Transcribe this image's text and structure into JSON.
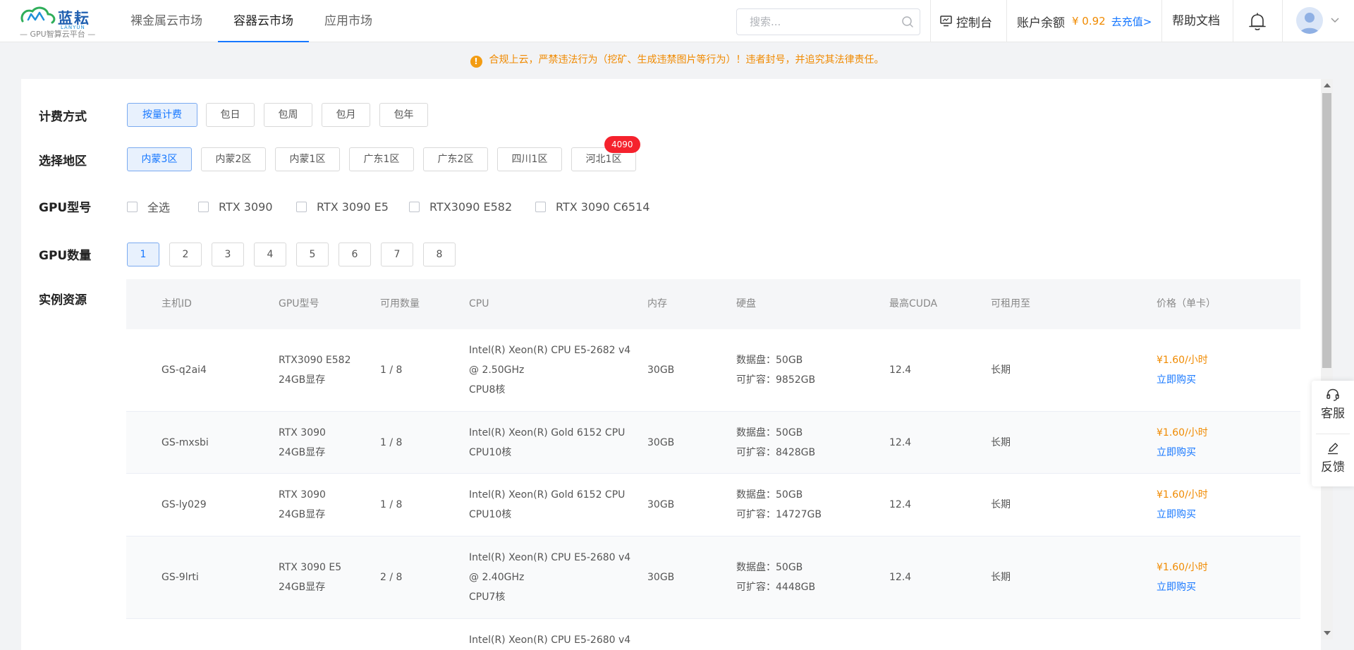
{
  "header": {
    "logo": {
      "name": "蓝耘",
      "en": "LANYUN",
      "subtitle": "GPU智算云平台"
    },
    "nav": [
      {
        "label": "裸金属云市场",
        "active": false
      },
      {
        "label": "容器云市场",
        "active": true
      },
      {
        "label": "应用市场",
        "active": false
      }
    ],
    "search_placeholder": "搜索...",
    "console_label": "控制台",
    "balance_label": "账户余额",
    "balance_amount": "¥ 0.92",
    "topup_label": "去充值>",
    "help_label": "帮助文档",
    "icons": [
      "search-icon",
      "monitor-icon",
      "bell-icon",
      "user-avatar",
      "chevron-down-icon"
    ]
  },
  "notice": {
    "text": "合规上云，严禁违法行为（挖矿、生成违禁图片等行为）！违者封号，并追究其法律责任。",
    "icon_glyph": "!"
  },
  "filters": {
    "billing": {
      "label": "计费方式",
      "options": [
        "按量计费",
        "包日",
        "包周",
        "包月",
        "包年"
      ],
      "selected": "按量计费"
    },
    "region": {
      "label": "选择地区",
      "options": [
        "内蒙3区",
        "内蒙2区",
        "内蒙1区",
        "广东1区",
        "广东2区",
        "四川1区",
        "河北1区"
      ],
      "selected": "内蒙3区",
      "badge": "4090"
    },
    "gpu_model": {
      "label": "GPU型号",
      "options": [
        "全选",
        "RTX 3090",
        "RTX 3090 E5",
        "RTX3090 E582",
        "RTX 3090 C6514"
      ]
    },
    "gpu_count": {
      "label": "GPU数量",
      "options": [
        "1",
        "2",
        "3",
        "4",
        "5",
        "6",
        "7",
        "8"
      ],
      "selected": "1"
    },
    "instances_label": "实例资源"
  },
  "table": {
    "columns": [
      "主机ID",
      "GPU型号",
      "可用数量",
      "CPU",
      "内存",
      "硬盘",
      "最高CUDA",
      "可租用至",
      "价格（单卡）"
    ],
    "rows": [
      {
        "id": "GS-q2ai4",
        "gpu": "RTX3090 E582",
        "vram": "24GB显存",
        "avail": "1 / 8",
        "cpu1": "Intel(R) Xeon(R) CPU E5-2682 v4",
        "cpu2": "@ 2.50GHz",
        "cpu3": "CPU8核",
        "mem": "30GB",
        "disk1": "数据盘：50GB",
        "disk2": "可扩容：9852GB",
        "cuda": "12.4",
        "lease": "长期",
        "price": "¥1.60/小时",
        "buy": "立即购买"
      },
      {
        "id": "GS-mxsbi",
        "gpu": "RTX 3090",
        "vram": "24GB显存",
        "avail": "1 / 8",
        "cpu1": "Intel(R) Xeon(R) Gold 6152 CPU",
        "cpu2": "CPU10核",
        "cpu3": "",
        "mem": "30GB",
        "disk1": "数据盘：50GB",
        "disk2": "可扩容：8428GB",
        "cuda": "12.4",
        "lease": "长期",
        "price": "¥1.60/小时",
        "buy": "立即购买"
      },
      {
        "id": "GS-ly029",
        "gpu": "RTX 3090",
        "vram": "24GB显存",
        "avail": "1 / 8",
        "cpu1": "Intel(R) Xeon(R) Gold 6152 CPU",
        "cpu2": "CPU10核",
        "cpu3": "",
        "mem": "30GB",
        "disk1": "数据盘：50GB",
        "disk2": "可扩容：14727GB",
        "cuda": "12.4",
        "lease": "长期",
        "price": "¥1.60/小时",
        "buy": "立即购买"
      },
      {
        "id": "GS-9lrti",
        "gpu": "RTX 3090 E5",
        "vram": "24GB显存",
        "avail": "2 / 8",
        "cpu1": "Intel(R) Xeon(R) CPU E5-2680 v4",
        "cpu2": "@ 2.40GHz",
        "cpu3": "CPU7核",
        "mem": "30GB",
        "disk1": "数据盘：50GB",
        "disk2": "可扩容：4448GB",
        "cuda": "12.4",
        "lease": "长期",
        "price": "¥1.60/小时",
        "buy": "立即购买"
      }
    ],
    "partial_row_text": "Intel(R) Xeon(R) CPU E5-2680 v4"
  },
  "side_float": {
    "service_label": "客服",
    "feedback_label": "反馈"
  },
  "colors": {
    "accent": "#1677ff",
    "price": "#f08a00",
    "badge": "#f5222d",
    "brand": "#1f5fb0"
  }
}
